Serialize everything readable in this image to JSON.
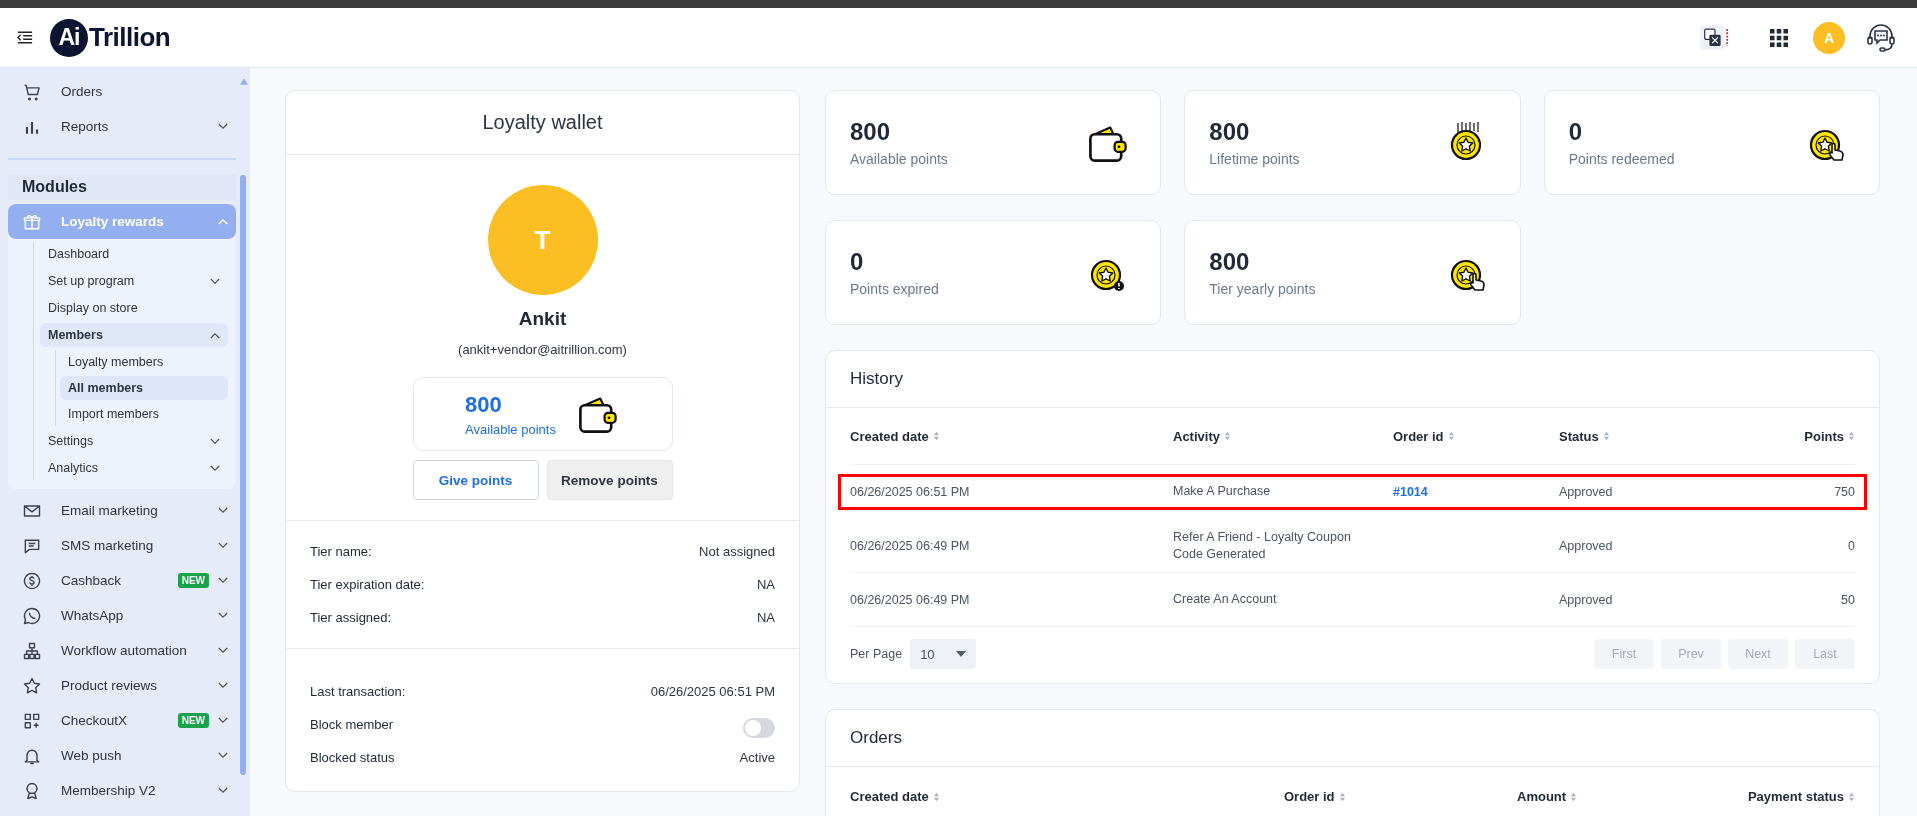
{
  "header": {
    "logo": {
      "mark": "Ai",
      "name": "Trillion"
    },
    "avatar": "A"
  },
  "sidebar": {
    "top_items": [
      {
        "label": "Orders",
        "selected": false
      },
      {
        "label": "Reports",
        "selected": false,
        "expanded": false
      }
    ],
    "section_title": "Modules",
    "modules": [
      {
        "label": "Loyalty rewards",
        "selected": true,
        "expanded": true,
        "children": [
          {
            "label": "Dashboard",
            "selected": false
          },
          {
            "label": "Set up program",
            "selected": false,
            "expanded": false
          },
          {
            "label": "Display on store",
            "selected": false
          },
          {
            "label": "Members",
            "selected": true,
            "expanded": true,
            "children": [
              {
                "label": "Loyalty members",
                "selected": false
              },
              {
                "label": "All members",
                "selected": true
              },
              {
                "label": "Import members",
                "selected": false
              }
            ]
          },
          {
            "label": "Settings",
            "selected": false,
            "expanded": false
          },
          {
            "label": "Analytics",
            "selected": false,
            "expanded": false
          }
        ]
      },
      {
        "label": "Email marketing",
        "selected": false,
        "expanded": false
      },
      {
        "label": "SMS marketing",
        "selected": false,
        "expanded": false
      },
      {
        "label": "Cashback",
        "selected": false,
        "expanded": false,
        "badge": "NEW"
      },
      {
        "label": "WhatsApp",
        "selected": false,
        "expanded": false
      },
      {
        "label": "Workflow automation",
        "selected": false,
        "expanded": false
      },
      {
        "label": "Product reviews",
        "selected": false,
        "expanded": false
      },
      {
        "label": "CheckoutX",
        "selected": false,
        "expanded": false,
        "badge": "NEW"
      },
      {
        "label": "Web push",
        "selected": false,
        "expanded": false
      },
      {
        "label": "Membership V2",
        "selected": false,
        "expanded": false
      }
    ]
  },
  "wallet": {
    "title": "Loyalty wallet",
    "avatar_initial": "T",
    "name": "Ankit",
    "email": "(ankit+vendor@aitrillion.com)",
    "points_value": "800",
    "points_label": "Available points",
    "buttons": [
      {
        "label": "Give points",
        "kind": "primary"
      },
      {
        "label": "Remove points",
        "kind": "secondary"
      }
    ],
    "tier_details": [
      {
        "label": "Tier name:",
        "value": "Not assigned"
      },
      {
        "label": "Tier expiration date:",
        "value": "NA"
      },
      {
        "label": "Tier assigned:",
        "value": "NA"
      }
    ],
    "other_details": [
      {
        "kind": "text",
        "label": "Last transaction:",
        "value": "06/26/2025 06:51 PM"
      },
      {
        "kind": "toggle",
        "label": "Block member",
        "on": false
      },
      {
        "kind": "text",
        "label": "Blocked status",
        "value": "Active"
      }
    ]
  },
  "stats": [
    {
      "value": "800",
      "label": "Available points",
      "kind": "wallet"
    },
    {
      "value": "800",
      "label": "Lifetime points",
      "kind": "coin-rain"
    },
    {
      "value": "0",
      "label": "Points redeemed",
      "kind": "coin-hand"
    },
    {
      "value": "0",
      "label": "Points expired",
      "kind": "coin-alert"
    },
    {
      "value": "800",
      "label": "Tier yearly points",
      "kind": "coin-hand"
    }
  ],
  "history": {
    "title": "History",
    "columns": [
      "Created date",
      "Activity",
      "Order id",
      "Status",
      "Points"
    ],
    "rows": [
      {
        "created_date": "06/26/2025 06:51 PM",
        "activity": "Make A Purchase",
        "order_id": "#1014",
        "status": "Approved",
        "points": "750",
        "highlighted": true
      },
      {
        "created_date": "06/26/2025 06:49 PM",
        "activity": "Refer A Friend - Loyalty Coupon Code Generated",
        "status": "Approved",
        "points": "0",
        "highlighted": false
      },
      {
        "created_date": "06/26/2025 06:49 PM",
        "activity": "Create An Account",
        "status": "Approved",
        "points": "50",
        "highlighted": false
      }
    ],
    "per_page_label": "Per Page",
    "per_page": "10",
    "pagination": [
      {
        "label": "First",
        "disabled": true
      },
      {
        "label": "Prev",
        "disabled": true
      },
      {
        "label": "Next",
        "disabled": true
      },
      {
        "label": "Last",
        "disabled": true
      }
    ]
  },
  "orders": {
    "title": "Orders",
    "columns": [
      "Created date",
      "Order id",
      "Amount",
      "Payment status"
    ]
  }
}
